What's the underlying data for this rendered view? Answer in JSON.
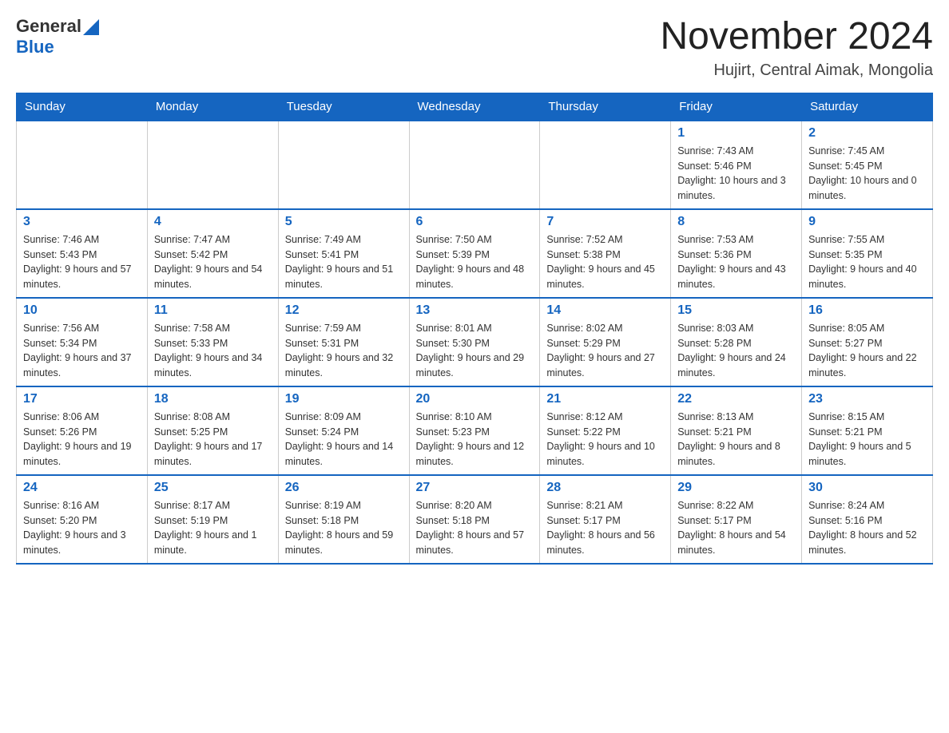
{
  "header": {
    "logo_general": "General",
    "logo_blue": "Blue",
    "title": "November 2024",
    "location": "Hujirt, Central Aimak, Mongolia"
  },
  "days_of_week": [
    "Sunday",
    "Monday",
    "Tuesday",
    "Wednesday",
    "Thursday",
    "Friday",
    "Saturday"
  ],
  "weeks": [
    [
      {
        "day": "",
        "info": ""
      },
      {
        "day": "",
        "info": ""
      },
      {
        "day": "",
        "info": ""
      },
      {
        "day": "",
        "info": ""
      },
      {
        "day": "",
        "info": ""
      },
      {
        "day": "1",
        "info": "Sunrise: 7:43 AM\nSunset: 5:46 PM\nDaylight: 10 hours and 3 minutes."
      },
      {
        "day": "2",
        "info": "Sunrise: 7:45 AM\nSunset: 5:45 PM\nDaylight: 10 hours and 0 minutes."
      }
    ],
    [
      {
        "day": "3",
        "info": "Sunrise: 7:46 AM\nSunset: 5:43 PM\nDaylight: 9 hours and 57 minutes."
      },
      {
        "day": "4",
        "info": "Sunrise: 7:47 AM\nSunset: 5:42 PM\nDaylight: 9 hours and 54 minutes."
      },
      {
        "day": "5",
        "info": "Sunrise: 7:49 AM\nSunset: 5:41 PM\nDaylight: 9 hours and 51 minutes."
      },
      {
        "day": "6",
        "info": "Sunrise: 7:50 AM\nSunset: 5:39 PM\nDaylight: 9 hours and 48 minutes."
      },
      {
        "day": "7",
        "info": "Sunrise: 7:52 AM\nSunset: 5:38 PM\nDaylight: 9 hours and 45 minutes."
      },
      {
        "day": "8",
        "info": "Sunrise: 7:53 AM\nSunset: 5:36 PM\nDaylight: 9 hours and 43 minutes."
      },
      {
        "day": "9",
        "info": "Sunrise: 7:55 AM\nSunset: 5:35 PM\nDaylight: 9 hours and 40 minutes."
      }
    ],
    [
      {
        "day": "10",
        "info": "Sunrise: 7:56 AM\nSunset: 5:34 PM\nDaylight: 9 hours and 37 minutes."
      },
      {
        "day": "11",
        "info": "Sunrise: 7:58 AM\nSunset: 5:33 PM\nDaylight: 9 hours and 34 minutes."
      },
      {
        "day": "12",
        "info": "Sunrise: 7:59 AM\nSunset: 5:31 PM\nDaylight: 9 hours and 32 minutes."
      },
      {
        "day": "13",
        "info": "Sunrise: 8:01 AM\nSunset: 5:30 PM\nDaylight: 9 hours and 29 minutes."
      },
      {
        "day": "14",
        "info": "Sunrise: 8:02 AM\nSunset: 5:29 PM\nDaylight: 9 hours and 27 minutes."
      },
      {
        "day": "15",
        "info": "Sunrise: 8:03 AM\nSunset: 5:28 PM\nDaylight: 9 hours and 24 minutes."
      },
      {
        "day": "16",
        "info": "Sunrise: 8:05 AM\nSunset: 5:27 PM\nDaylight: 9 hours and 22 minutes."
      }
    ],
    [
      {
        "day": "17",
        "info": "Sunrise: 8:06 AM\nSunset: 5:26 PM\nDaylight: 9 hours and 19 minutes."
      },
      {
        "day": "18",
        "info": "Sunrise: 8:08 AM\nSunset: 5:25 PM\nDaylight: 9 hours and 17 minutes."
      },
      {
        "day": "19",
        "info": "Sunrise: 8:09 AM\nSunset: 5:24 PM\nDaylight: 9 hours and 14 minutes."
      },
      {
        "day": "20",
        "info": "Sunrise: 8:10 AM\nSunset: 5:23 PM\nDaylight: 9 hours and 12 minutes."
      },
      {
        "day": "21",
        "info": "Sunrise: 8:12 AM\nSunset: 5:22 PM\nDaylight: 9 hours and 10 minutes."
      },
      {
        "day": "22",
        "info": "Sunrise: 8:13 AM\nSunset: 5:21 PM\nDaylight: 9 hours and 8 minutes."
      },
      {
        "day": "23",
        "info": "Sunrise: 8:15 AM\nSunset: 5:21 PM\nDaylight: 9 hours and 5 minutes."
      }
    ],
    [
      {
        "day": "24",
        "info": "Sunrise: 8:16 AM\nSunset: 5:20 PM\nDaylight: 9 hours and 3 minutes."
      },
      {
        "day": "25",
        "info": "Sunrise: 8:17 AM\nSunset: 5:19 PM\nDaylight: 9 hours and 1 minute."
      },
      {
        "day": "26",
        "info": "Sunrise: 8:19 AM\nSunset: 5:18 PM\nDaylight: 8 hours and 59 minutes."
      },
      {
        "day": "27",
        "info": "Sunrise: 8:20 AM\nSunset: 5:18 PM\nDaylight: 8 hours and 57 minutes."
      },
      {
        "day": "28",
        "info": "Sunrise: 8:21 AM\nSunset: 5:17 PM\nDaylight: 8 hours and 56 minutes."
      },
      {
        "day": "29",
        "info": "Sunrise: 8:22 AM\nSunset: 5:17 PM\nDaylight: 8 hours and 54 minutes."
      },
      {
        "day": "30",
        "info": "Sunrise: 8:24 AM\nSunset: 5:16 PM\nDaylight: 8 hours and 52 minutes."
      }
    ]
  ]
}
